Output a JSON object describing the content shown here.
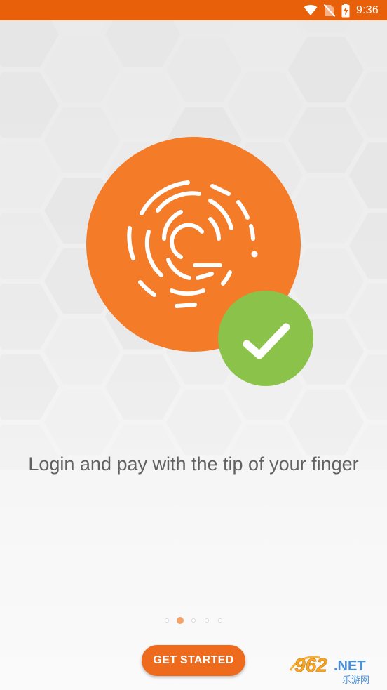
{
  "status_bar": {
    "time": "9:36"
  },
  "onboarding": {
    "message": "Login and pay with the tip of your finger",
    "page_count": 5,
    "current_page": 2,
    "cta_label": "GET STARTED"
  },
  "watermark": {
    "text_main": "962",
    "text_suffix": ".NET",
    "text_sub": "乐游网"
  },
  "colors": {
    "status_bar": "#e8610a",
    "brand_orange": "#f47b28",
    "success_green": "#8bc34a",
    "button": "#ee6a1c",
    "text": "#616161",
    "dot_active": "#f4a46a",
    "dot_inactive": "#dcdcdc"
  }
}
